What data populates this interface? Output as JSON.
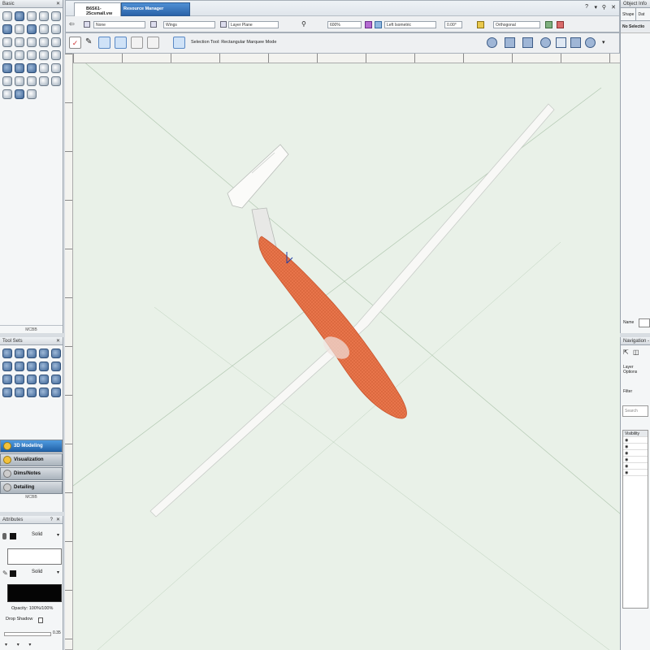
{
  "left_palette": {
    "title": "Basic",
    "bottom_label": "MCBB",
    "tool_sets_title": "Tool Sets",
    "modes": [
      {
        "label": "3D Modeling",
        "active": true
      },
      {
        "label": "Visualization",
        "active": false
      },
      {
        "label": "Dims/Notes",
        "active": false
      },
      {
        "label": "Detailing",
        "active": false
      }
    ],
    "modes_footer": "MCBB"
  },
  "attributes": {
    "title": "Attributes",
    "fill_style": "Solid",
    "pen_style": "Solid",
    "opacity_label": "Opacity: 100%/100%",
    "drop_shadow_label": "Drop Shadow",
    "thickness_value": "0.35"
  },
  "document": {
    "tab_title": "B6S61-25csmall.vw",
    "resource_manager_tab": "Resource Manager"
  },
  "view_bar": {
    "class_value": "None",
    "design_layer_value": "Wings",
    "layer_plane_value": "Layer Plane",
    "zoom_value": "600%",
    "view_value": "Left Isometric",
    "rotation_value": "0.00°",
    "projection_value": "Orthogonal"
  },
  "mode_bar": {
    "status_text": "Selection Tool: Rectangular Marquee Mode"
  },
  "object_info": {
    "title": "Object Info",
    "tabs": [
      "Shape",
      "Dat"
    ],
    "no_selection": "No Selectio",
    "name_label": "Name"
  },
  "navigation": {
    "title": "Navigation -",
    "layer_options_label": "Layer Options",
    "filter_label": "Filter",
    "search_placeholder": "Search",
    "visibility_header": "Visibility"
  },
  "colors": {
    "canvas": "#e9f1e8",
    "fuselage": "#e8744a",
    "wing": "#f8f8f6",
    "accent_blue": "#1f5fa5"
  }
}
